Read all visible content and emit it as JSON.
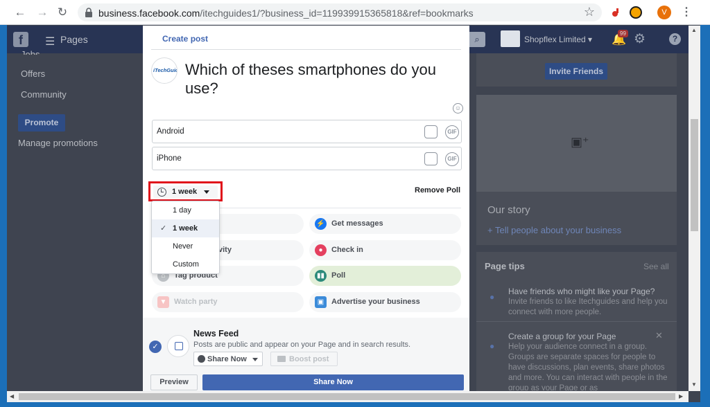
{
  "browser": {
    "url_host": "business.facebook.com",
    "url_path": "/itechguides1/?business_id=119939915365818&ref=bookmarks",
    "profile_initial": "V"
  },
  "fb_header": {
    "section_label": "Pages",
    "page_name": "Shopflex Limited",
    "notification_count": "99"
  },
  "left_nav": {
    "items": [
      "Jobs",
      "Offers",
      "Community"
    ],
    "promote_label": "Promote",
    "manage_promotions": "Manage promotions"
  },
  "right_col": {
    "invite_label": "Invite Friends",
    "story_title": "Our story",
    "story_link": "+ Tell people about your business",
    "tips_title": "Page tips",
    "see_all": "See all",
    "tips": [
      {
        "title": "Have friends who might like your Page?",
        "body": "Invite friends to like Itechguides and help you connect with more people."
      },
      {
        "title": "Create a group for your Page",
        "body": "Help your audience connect in a group. Groups are separate spaces for people to have discussions, plan events, share photos and more. You can interact with people in the group as your Page or as"
      }
    ]
  },
  "modal": {
    "title": "Create post",
    "page_logo_text": "iTechGuides",
    "question": "Which of theses smartphones do you use?",
    "poll_options": [
      "Android",
      "iPhone"
    ],
    "gif_label": "GIF",
    "duration": {
      "selected": "1 week",
      "options": [
        "1 day",
        "1 week",
        "Never",
        "Custom"
      ]
    },
    "remove_poll": "Remove Poll",
    "actions": {
      "activity_partial": "vity",
      "tag_product": "Tag product",
      "watch_party": "Watch party",
      "get_messages": "Get messages",
      "check_in": "Check in",
      "poll": "Poll",
      "advertise": "Advertise your business"
    },
    "feed": {
      "title": "News Feed",
      "description": "Posts are public and appear on your Page and in search results.",
      "share_now": "Share Now",
      "boost": "Boost post"
    },
    "preview_label": "Preview",
    "share_label": "Share Now"
  },
  "colors": {
    "fb_blue": "#4267b2",
    "highlight_red": "#e0101a",
    "poll_green": "#e3efd9"
  }
}
